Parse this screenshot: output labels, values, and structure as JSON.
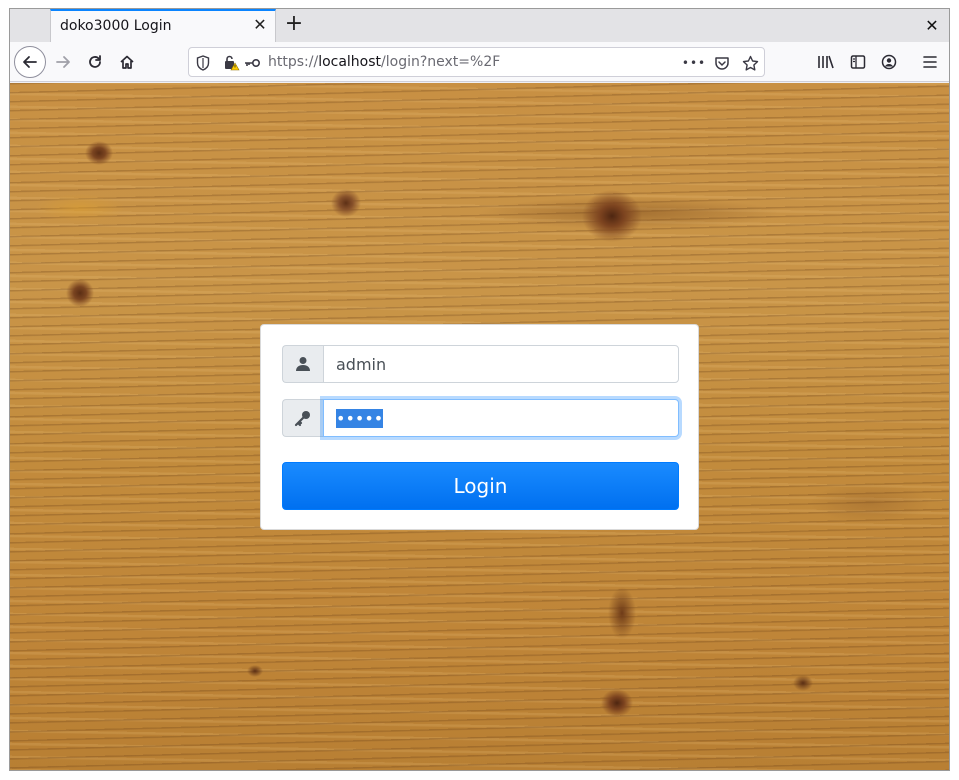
{
  "browser": {
    "tab_title": "doko3000 Login",
    "tab_close_icon": "close-icon",
    "new_tab_label": "+",
    "window_close_label": "✕",
    "url": {
      "scheme": "https://",
      "host": "localhost",
      "path": "/login?next=%2F"
    },
    "page_actions_label": "•••"
  },
  "login": {
    "username_value": "admin",
    "password_value": "•••••",
    "password_length": 5,
    "submit_label": "Login"
  },
  "colors": {
    "accent": "#0a84ff",
    "button": "#007bff",
    "wood": "#c8923f"
  }
}
